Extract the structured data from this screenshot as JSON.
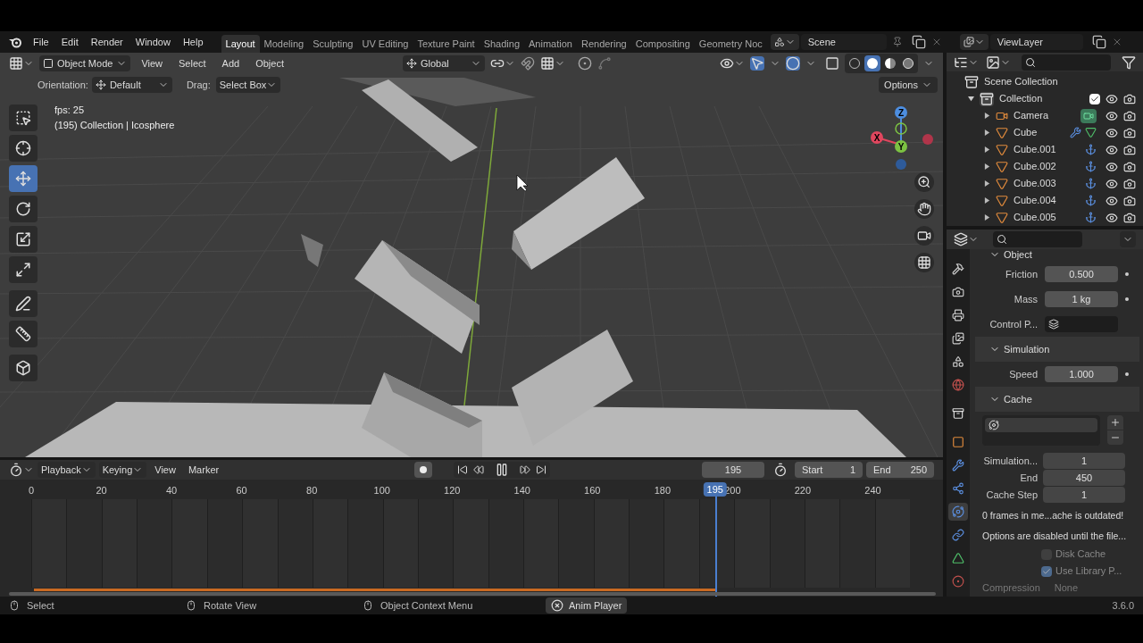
{
  "top_menu": [
    "File",
    "Edit",
    "Render",
    "Window",
    "Help"
  ],
  "workspaces": [
    {
      "label": "Layout",
      "selected": true
    },
    {
      "label": "Modeling",
      "selected": false
    },
    {
      "label": "Sculpting",
      "selected": false
    },
    {
      "label": "UV Editing",
      "selected": false
    },
    {
      "label": "Texture Paint",
      "selected": false
    },
    {
      "label": "Shading",
      "selected": false
    },
    {
      "label": "Animation",
      "selected": false
    },
    {
      "label": "Rendering",
      "selected": false
    },
    {
      "label": "Compositing",
      "selected": false
    },
    {
      "label": "Geometry Noc",
      "selected": false
    }
  ],
  "scene": "Scene",
  "view_layer": "ViewLayer",
  "viewport": {
    "mode": "Object Mode",
    "menus": [
      "View",
      "Select",
      "Add",
      "Object"
    ],
    "transform_orientation": "Global",
    "orientation_label": "Orientation:",
    "orientation": "Default",
    "drag_label": "Drag:",
    "drag": "Select Box",
    "options": "Options",
    "overlay_lines": [
      "fps: 25",
      "(195) Collection | Icosphere"
    ],
    "gizmos_on": true,
    "overlays_on": true,
    "shading_modes": [
      {
        "kind": "wireframe",
        "selected": false
      },
      {
        "kind": "solid",
        "selected": true
      },
      {
        "kind": "material",
        "selected": false
      },
      {
        "kind": "rendered",
        "selected": false
      }
    ],
    "tools": [
      {
        "kind": "select",
        "selected": false
      },
      {
        "kind": "cursor",
        "selected": false
      },
      {
        "kind": "move",
        "selected": true
      },
      {
        "kind": "rotate",
        "selected": false
      },
      {
        "kind": "scale",
        "selected": false
      },
      {
        "kind": "transform",
        "selected": false
      },
      {
        "kind": "annotate",
        "selected": false
      },
      {
        "kind": "measure",
        "selected": false
      },
      {
        "kind": "add-cube",
        "selected": false
      }
    ],
    "gizmo_axes": [
      "X",
      "Y",
      "Z"
    ]
  },
  "outliner": {
    "root": "Scene Collection",
    "collection": {
      "label": "Collection",
      "expanded": true,
      "checked": true,
      "children": [
        {
          "label": "Camera",
          "kind": "camera",
          "expanded": false,
          "icons": [
            {
              "kind": "camera-data"
            }
          ]
        },
        {
          "label": "Cube",
          "kind": "mesh",
          "expanded": false,
          "icons": [
            {
              "kind": "wrench"
            },
            {
              "kind": "mesh-data"
            }
          ]
        },
        {
          "label": "Cube.001",
          "kind": "mesh",
          "expanded": false,
          "icons": [
            {
              "kind": "hook"
            }
          ]
        },
        {
          "label": "Cube.002",
          "kind": "mesh",
          "expanded": false,
          "icons": [
            {
              "kind": "hook"
            }
          ]
        },
        {
          "label": "Cube.003",
          "kind": "mesh",
          "expanded": false,
          "icons": [
            {
              "kind": "hook"
            }
          ]
        },
        {
          "label": "Cube.004",
          "kind": "mesh",
          "expanded": false,
          "icons": [
            {
              "kind": "hook"
            }
          ]
        },
        {
          "label": "Cube.005",
          "kind": "mesh",
          "expanded": false,
          "icons": [
            {
              "kind": "hook"
            }
          ]
        }
      ]
    }
  },
  "properties": {
    "tabs": [
      {
        "kind": "tool",
        "selected": false
      },
      {
        "kind": "render",
        "selected": false
      },
      {
        "kind": "output",
        "selected": false
      },
      {
        "kind": "view-layer",
        "selected": false
      },
      {
        "kind": "scene",
        "selected": false
      },
      {
        "kind": "world",
        "selected": false
      },
      {
        "kind": "collection",
        "selected": false
      },
      {
        "kind": "object",
        "selected": false
      },
      {
        "kind": "modifiers",
        "selected": false
      },
      {
        "kind": "particles",
        "selected": false
      },
      {
        "kind": "physics",
        "selected": true
      },
      {
        "kind": "constraints",
        "selected": false
      },
      {
        "kind": "data",
        "selected": false
      },
      {
        "kind": "material",
        "selected": false
      }
    ],
    "object_panel": {
      "title": "Object",
      "fields": [
        {
          "label": "Friction",
          "value": "0.500",
          "kind": "number"
        },
        {
          "label": "Mass",
          "value": "1 kg",
          "kind": "number"
        },
        {
          "label": "Control P...",
          "kind": "collection"
        }
      ]
    },
    "simulation_panel": {
      "title": "Simulation",
      "fields": [
        {
          "label": "Speed",
          "value": "1.000",
          "kind": "number"
        }
      ]
    },
    "cache_panel": {
      "title": "Cache",
      "fields": [
        {
          "label": "Simulation...",
          "value": "1"
        },
        {
          "label": "End",
          "value": "450"
        },
        {
          "label": "Cache Step",
          "value": "1"
        }
      ],
      "messages": [
        "0 frames in me...ache is outdated!",
        "Options are disabled until the file..."
      ],
      "checkboxes": [
        {
          "label": "Disk Cache",
          "checked": false
        },
        {
          "label": "Use Library P...",
          "checked": true
        }
      ],
      "compression_label": "Compression",
      "compression": "None"
    }
  },
  "timeline": {
    "menus": [
      "Playback",
      "Keying",
      "View",
      "Marker"
    ],
    "current_frame": "195",
    "start_label": "Start",
    "start": "1",
    "end_label": "End",
    "end": "250",
    "ticks": [
      "0",
      "20",
      "40",
      "60",
      "80",
      "100",
      "120",
      "140",
      "160",
      "180",
      "200",
      "220",
      "240"
    ],
    "playhead": "195",
    "level": 0.75
  },
  "status_bar": {
    "hints": [
      "Select",
      "Rotate View",
      "Object Context Menu"
    ],
    "anim_player": "Anim Player",
    "version": "3.6.0"
  }
}
